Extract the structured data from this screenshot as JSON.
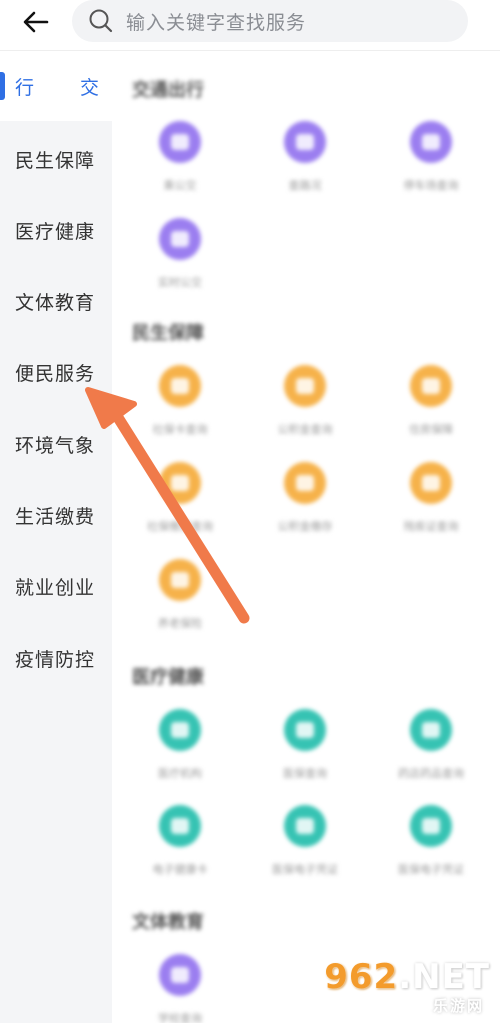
{
  "header": {
    "back_icon": "arrow-left-icon",
    "search_icon": "search-icon",
    "search_placeholder": "输入关键字查找服务"
  },
  "sidebar": {
    "active_index": 0,
    "items": [
      {
        "label": "行",
        "label_right": "交"
      },
      {
        "label": "民生保障"
      },
      {
        "label": "医疗健康"
      },
      {
        "label": "文体教育"
      },
      {
        "label": "便民服务"
      },
      {
        "label": "环境气象"
      },
      {
        "label": "生活缴费"
      },
      {
        "label": "就业创业"
      },
      {
        "label": "疫情防控"
      }
    ]
  },
  "content": {
    "sections": [
      {
        "title": "交通出行",
        "color": "#9b7ef0",
        "items": [
          "乘公交",
          "查路况",
          "停车场查询",
          "实时公交"
        ]
      },
      {
        "title": "民生保障",
        "color": "#f6b24a",
        "items": [
          "社保卡查询",
          "公积金查询",
          "住房保障",
          "社保缴费查询",
          "公积金缴存",
          "残疾证查询",
          "养老保险"
        ]
      },
      {
        "title": "医疗健康",
        "color": "#36c3b3",
        "items": [
          "医疗机构",
          "医保查询",
          "药店药品查询",
          "电子健康卡",
          "医保电子凭证",
          "医保电子凭证"
        ]
      },
      {
        "title": "文体教育",
        "color": "#9b7ef0",
        "items": [
          "学校查询"
        ]
      }
    ]
  },
  "colors": {
    "accent": "#2f6fe4",
    "arrow": "#f07a4a"
  },
  "watermark": {
    "number": "962",
    "suffix": ".NET",
    "sub": "乐游网"
  }
}
